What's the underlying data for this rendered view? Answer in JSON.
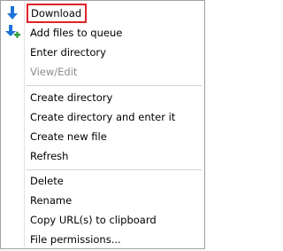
{
  "menu": {
    "items": [
      {
        "label": "Download",
        "icon": "download-arrow-icon",
        "highlighted": true
      },
      {
        "label": "Add files to queue",
        "icon": "add-to-queue-icon"
      },
      {
        "label": "Enter directory"
      },
      {
        "label": "View/Edit",
        "disabled": true
      },
      {
        "label": "Create directory"
      },
      {
        "label": "Create directory and enter it"
      },
      {
        "label": "Create new file"
      },
      {
        "label": "Refresh"
      },
      {
        "label": "Delete"
      },
      {
        "label": "Rename"
      },
      {
        "label": "Copy URL(s) to clipboard"
      },
      {
        "label": "File permissions..."
      }
    ]
  },
  "colors": {
    "icon_blue": "#1e73d8",
    "icon_green": "#2e9e3a",
    "highlight_border": "#e0232a",
    "disabled_text": "#8d8d8d"
  }
}
